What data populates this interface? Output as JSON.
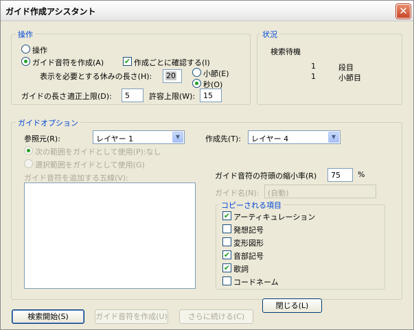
{
  "window": {
    "title": "ガイド作成アシスタント",
    "close_symbol": "✕"
  },
  "operation": {
    "legend": "操作",
    "radio_operation": "操作",
    "radio_create_guide": "ガイド音符を作成(A)",
    "check_confirm_each": "作成ごとに確認する(I)",
    "rest_length_label": "表示を必要とする休みの長さ(H):",
    "rest_length_value": "20",
    "radio_bar": "小節(E)",
    "radio_sec": "秒(O)",
    "guide_length_label": "ガイドの長さ",
    "upper_label": "適正上限(D):",
    "upper_value": "5",
    "allow_label": "許容上限(W):",
    "allow_value": "15"
  },
  "status": {
    "legend": "状況",
    "state": "検索待機",
    "row1_num": "1",
    "row1_label": "段目",
    "row2_num": "1",
    "row2_label": "小節目"
  },
  "guide_options": {
    "legend": "ガイドオプション",
    "ref_label": "参照元(R):",
    "ref_value": "レイヤー 1",
    "dest_label": "作成先(T):",
    "dest_value": "レイヤー 4",
    "radio_next_range": "次の範囲をガイドとして使用(P):なし",
    "radio_selected_range": "選択範囲をガイドとして使用(G)",
    "staff_list_label": "ガイド音符を追加する五線(V):",
    "head_scale_label": "ガイド音符の符頭の縮小率(R)",
    "head_scale_value": "75",
    "head_scale_unit": "%",
    "guide_name_label": "ガイド名(N):",
    "guide_name_value": "(自動)"
  },
  "copied_items": {
    "legend": "コピーされる項目",
    "items": [
      {
        "label": "アーティキュレーション",
        "checked": "✔"
      },
      {
        "label": "発想記号",
        "checked": ""
      },
      {
        "label": "変形図形",
        "checked": ""
      },
      {
        "label": "音部記号",
        "checked": "✔"
      },
      {
        "label": "歌詞",
        "checked": "✔"
      },
      {
        "label": "コードネーム",
        "checked": ""
      }
    ]
  },
  "buttons": {
    "close": "閉じる(L)",
    "search_start": "検索開始(S)",
    "create_guide": "ガイド音符を作成(U)",
    "continue": "さらに続ける(C)"
  }
}
